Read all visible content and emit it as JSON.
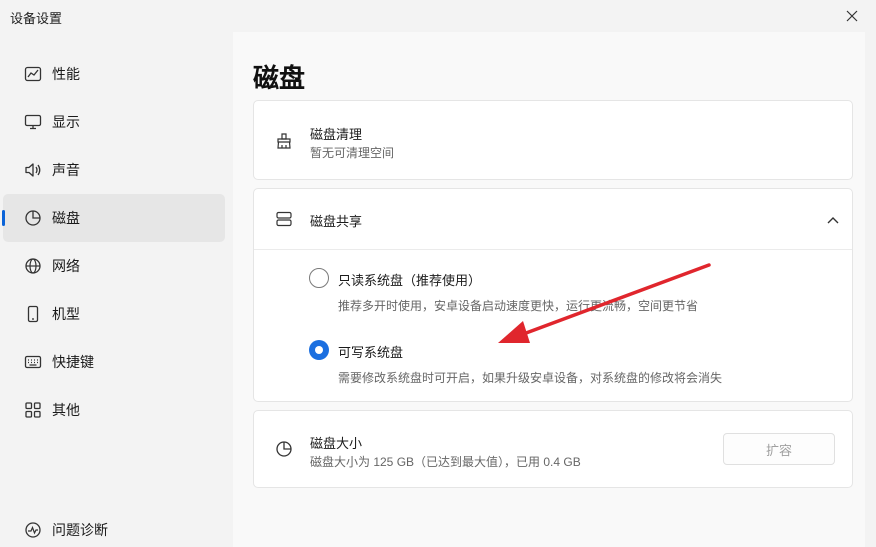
{
  "window": {
    "title": "设备设置"
  },
  "sidebar": {
    "items": [
      {
        "label": "性能",
        "icon": "performance-chart-icon"
      },
      {
        "label": "显示",
        "icon": "monitor-icon"
      },
      {
        "label": "声音",
        "icon": "speaker-icon"
      },
      {
        "label": "磁盘",
        "icon": "pie-chart-icon",
        "active": true
      },
      {
        "label": "网络",
        "icon": "globe-icon"
      },
      {
        "label": "机型",
        "icon": "phone-icon"
      },
      {
        "label": "快捷键",
        "icon": "keyboard-icon"
      },
      {
        "label": "其他",
        "icon": "grid-icon"
      },
      {
        "label": "问题诊断",
        "icon": "diagnostics-icon"
      }
    ]
  },
  "page": {
    "title": "磁盘"
  },
  "disk_cleanup": {
    "title": "磁盘清理",
    "subtitle": "暂无可清理空间",
    "icon": "brush-icon"
  },
  "disk_sharing": {
    "title": "磁盘共享",
    "icon": "disk-stack-icon",
    "expanded": true,
    "options": [
      {
        "label": "只读系统盘（推荐使用）",
        "description": "推荐多开时使用，安卓设备启动速度更快，运行更流畅，空间更节省",
        "checked": false
      },
      {
        "label": "可写系统盘",
        "description": "需要修改系统盘时可开启，如果升级安卓设备，对系统盘的修改将会消失",
        "checked": true
      }
    ]
  },
  "disk_size": {
    "title": "磁盘大小",
    "subtitle": "磁盘大小为 125 GB（已达到最大值），已用 0.4 GB",
    "icon": "pie-chart-icon",
    "button_label": "扩容",
    "button_enabled": false
  },
  "annotation": {
    "color": "#e0262d"
  }
}
